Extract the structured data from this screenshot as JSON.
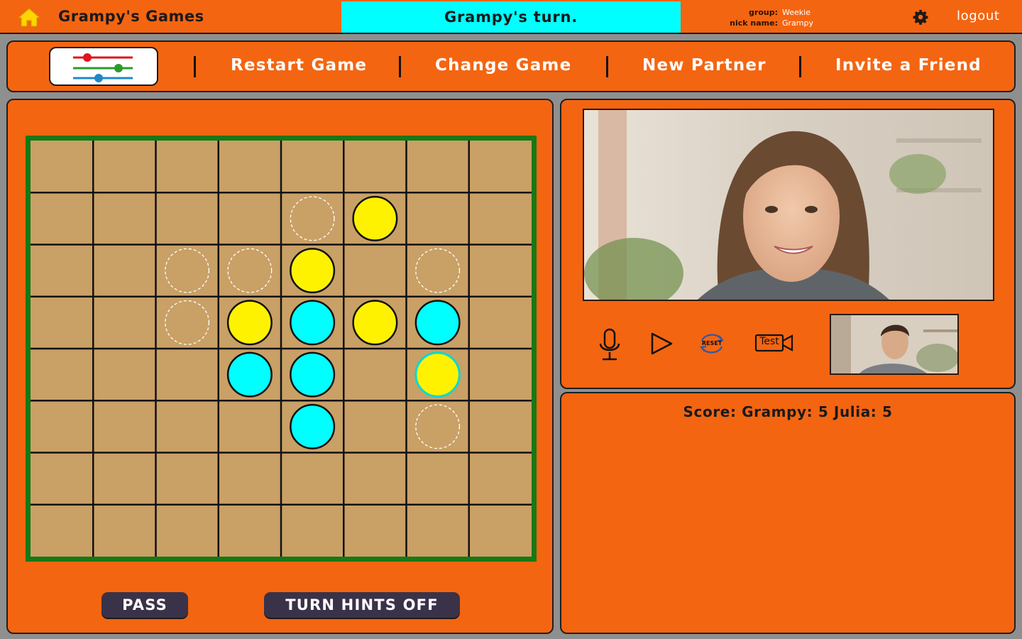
{
  "header": {
    "title": "Grampy's Games",
    "turn_status": "Grampy's turn.",
    "group_label": "group:",
    "group_value": "Weekie",
    "nick_label": "nick name:",
    "nick_value": "Grampy",
    "logout_label": "logout",
    "home_icon": "home-icon",
    "settings_icon": "gear-icon"
  },
  "menu": {
    "settings_icon": "sliders-icon",
    "items": [
      {
        "label": "Restart Game"
      },
      {
        "label": "Change Game"
      },
      {
        "label": "New Partner"
      },
      {
        "label": "Invite a Friend"
      }
    ]
  },
  "game": {
    "board_size": 8,
    "pieces": [
      {
        "row": 1,
        "col": 5,
        "color": "yellow"
      },
      {
        "row": 2,
        "col": 4,
        "color": "yellow"
      },
      {
        "row": 3,
        "col": 3,
        "color": "yellow"
      },
      {
        "row": 3,
        "col": 4,
        "color": "cyan"
      },
      {
        "row": 3,
        "col": 5,
        "color": "yellow"
      },
      {
        "row": 3,
        "col": 6,
        "color": "cyan"
      },
      {
        "row": 4,
        "col": 3,
        "color": "cyan"
      },
      {
        "row": 4,
        "col": 4,
        "color": "cyan"
      },
      {
        "row": 4,
        "col": 6,
        "color": "yellow",
        "last_move": true
      },
      {
        "row": 5,
        "col": 4,
        "color": "cyan"
      }
    ],
    "hints": [
      {
        "row": 1,
        "col": 4
      },
      {
        "row": 2,
        "col": 2
      },
      {
        "row": 2,
        "col": 3
      },
      {
        "row": 2,
        "col": 6
      },
      {
        "row": 3,
        "col": 2
      },
      {
        "row": 5,
        "col": 6
      }
    ],
    "pass_label": "PASS",
    "hints_label": "TURN HINTS OFF"
  },
  "video": {
    "controls": [
      {
        "icon": "microphone-icon"
      },
      {
        "icon": "play-icon"
      },
      {
        "icon": "reset-icon",
        "label": "RESET"
      },
      {
        "icon": "test-camera-icon",
        "label": "Test"
      }
    ]
  },
  "score": {
    "text": "Score: Grampy: 5  Julia: 5"
  },
  "colors": {
    "orange": "#f46511",
    "cyan": "#00ffff",
    "yellow": "#fff200",
    "board": "#c9a066",
    "board_border": "#177816",
    "button": "#3a3248"
  }
}
